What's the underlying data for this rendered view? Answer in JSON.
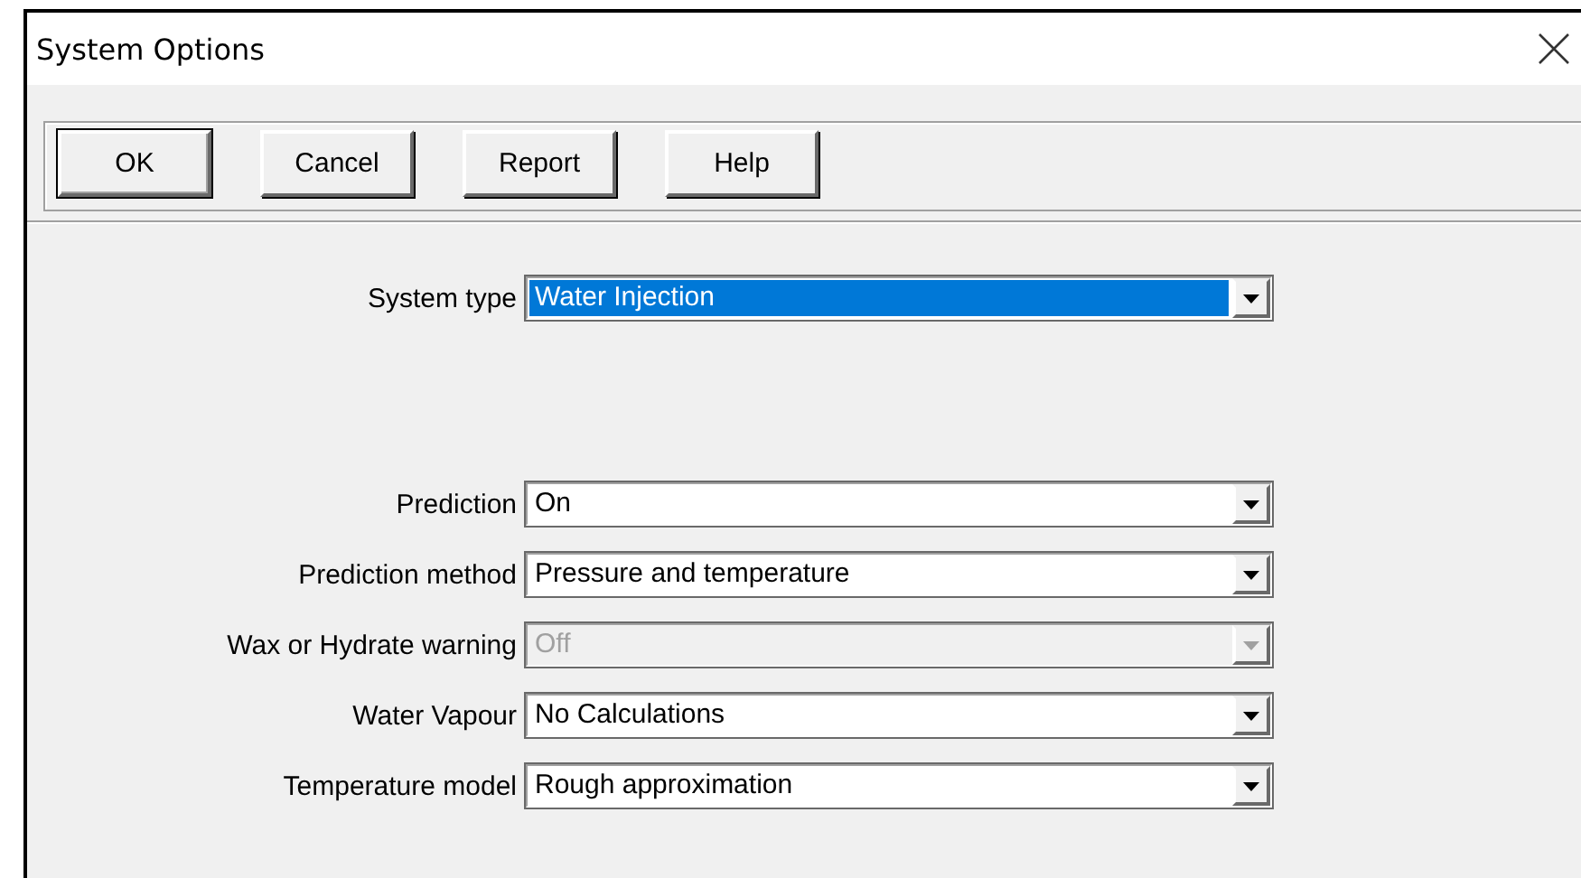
{
  "window": {
    "title": "System Options"
  },
  "buttons": [
    {
      "label": "OK",
      "default": true
    },
    {
      "label": "Cancel",
      "default": false
    },
    {
      "label": "Report",
      "default": false
    },
    {
      "label": "Help",
      "default": false
    }
  ],
  "system_type": {
    "label": "System type",
    "value": "Water Injection",
    "highlighted": true,
    "disabled": false
  },
  "fields": [
    {
      "label": "Prediction",
      "value": "On",
      "highlighted": false,
      "disabled": false
    },
    {
      "label": "Prediction method",
      "value": "Pressure and temperature",
      "highlighted": false,
      "disabled": false
    },
    {
      "label": "Wax or Hydrate warning",
      "value": "Off",
      "highlighted": false,
      "disabled": true
    },
    {
      "label": "Water Vapour",
      "value": "No Calculations",
      "highlighted": false,
      "disabled": false
    },
    {
      "label": "Temperature model",
      "value": "Rough approximation",
      "highlighted": false,
      "disabled": false
    }
  ]
}
